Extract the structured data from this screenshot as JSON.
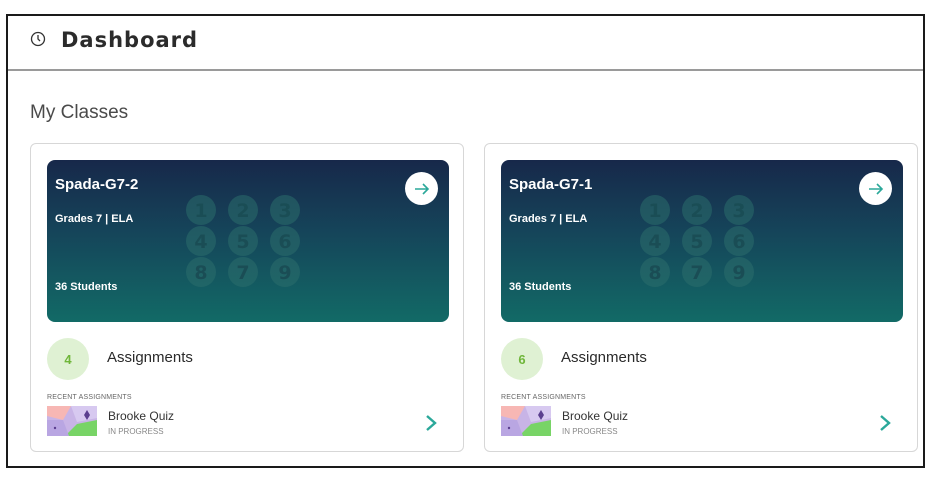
{
  "header": {
    "title": "Dashboard",
    "icon": "clock-icon"
  },
  "section": {
    "title": "My Classes"
  },
  "numerals": [
    "1",
    "2",
    "3",
    "4",
    "5",
    "6",
    "8",
    "7",
    "9"
  ],
  "classes": [
    {
      "name": "Spada-G7-2",
      "meta": "Grades 7  |  ELA",
      "students": "36 Students",
      "assignment_count": "4",
      "assignments_label": "Assignments",
      "recent_label": "RECENT ASSIGNMENTS",
      "quiz_name": "Brooke Quiz",
      "quiz_status": "IN PROGRESS"
    },
    {
      "name": "Spada-G7-1",
      "meta": "Grades 7  |  ELA",
      "students": "36 Students",
      "assignment_count": "6",
      "assignments_label": "Assignments",
      "recent_label": "RECENT ASSIGNMENTS",
      "quiz_name": "Brooke Quiz",
      "quiz_status": "IN PROGRESS"
    }
  ],
  "colors": {
    "accent_teal": "#2ba89a",
    "banner_top": "#17284a",
    "banner_bottom": "#126a66",
    "count_bg": "#dff1d3",
    "count_text": "#6fb63a"
  }
}
